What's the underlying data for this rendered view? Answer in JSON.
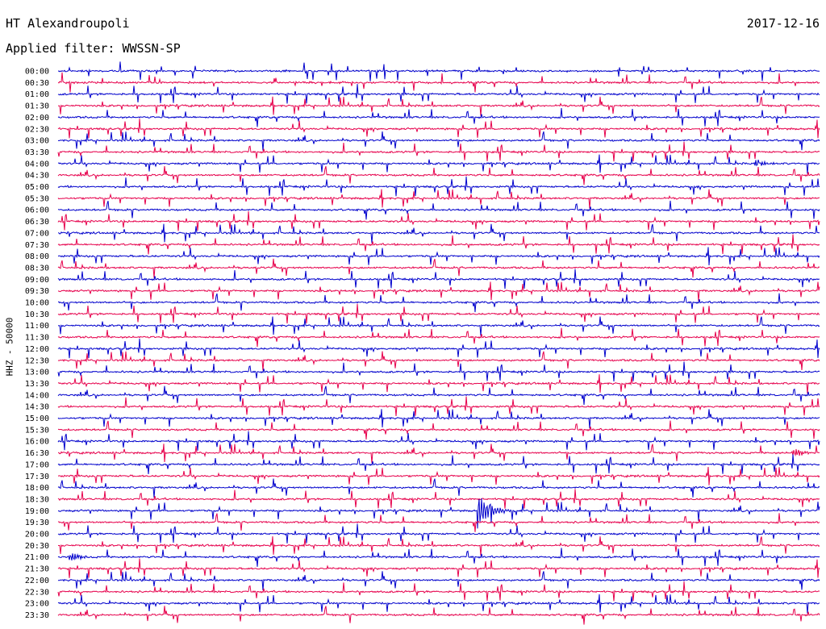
{
  "header": {
    "station": "HT Alexandroupoli",
    "date": "2017-12-16",
    "filter_label": "Applied filter: WWSSN-SP"
  },
  "chart_data": {
    "type": "line",
    "title": "HT Alexandroupoli",
    "ylabel": "HHZ - 50000",
    "row_labels": [
      "00:00",
      "00:30",
      "01:00",
      "01:30",
      "02:00",
      "02:30",
      "03:00",
      "03:30",
      "04:00",
      "04:30",
      "05:00",
      "05:30",
      "06:00",
      "06:30",
      "07:00",
      "07:30",
      "08:00",
      "08:30",
      "09:00",
      "09:30",
      "10:00",
      "10:30",
      "11:00",
      "11:30",
      "12:00",
      "12:30",
      "13:00",
      "13:30",
      "14:00",
      "14:30",
      "15:00",
      "15:30",
      "16:00",
      "16:30",
      "17:00",
      "17:30",
      "18:00",
      "18:30",
      "19:00",
      "19:30",
      "20:00",
      "20:30",
      "21:00",
      "21:30",
      "22:00",
      "22:30",
      "23:00",
      "23:30"
    ],
    "series_colors": [
      "#0000cc",
      "#e6004c"
    ],
    "events": [
      {
        "row": "04:00",
        "position": 0.92,
        "kind": "local event"
      },
      {
        "row": "19:00",
        "position": 0.55,
        "kind": "earthquake"
      },
      {
        "row": "16:30",
        "position": 0.97,
        "kind": "local event"
      },
      {
        "row": "21:00",
        "position": 0.02,
        "kind": "local event"
      }
    ]
  }
}
